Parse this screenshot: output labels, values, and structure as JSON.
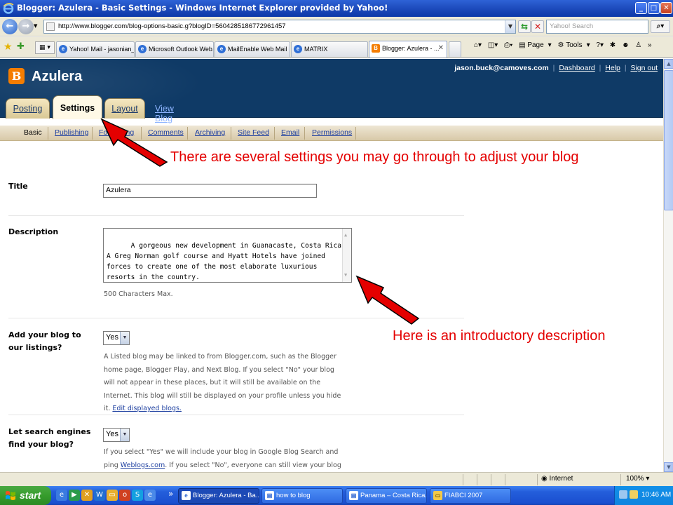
{
  "window": {
    "title": "Blogger: Azulera - Basic Settings - Windows Internet Explorer provided by Yahoo!",
    "controls": [
      "_",
      "□",
      "✕"
    ]
  },
  "address_bar": {
    "url": "http://www.blogger.com/blog-options-basic.g?blogID=5604285186772961457",
    "search_placeholder": "Yahoo! Search"
  },
  "browser_tabs": [
    {
      "label": "Yahoo! Mail - jasonian_..."
    },
    {
      "label": "Microsoft Outlook Web..."
    },
    {
      "label": "MailEnable Web Mail"
    },
    {
      "label": "MATRIX"
    },
    {
      "label": "Blogger: Azulera - ...",
      "active": true
    }
  ],
  "command_bar": {
    "page": "Page",
    "tools": "Tools"
  },
  "blogger": {
    "blog_name": "Azulera",
    "user_email": "jason.buck@camoves.com",
    "links": {
      "dashboard": "Dashboard",
      "help": "Help",
      "sign_out": "Sign out"
    },
    "main_tabs": {
      "posting": "Posting",
      "settings": "Settings",
      "layout": "Layout",
      "view_blog": "View Blog"
    },
    "sub_tabs": [
      "Basic",
      "Publishing",
      "Formatting",
      "Comments",
      "Archiving",
      "Site Feed",
      "Email",
      "Permissions"
    ]
  },
  "form": {
    "title_label": "Title",
    "title_value": "Azulera",
    "description_label": "Description",
    "description_value": "A gorgeous new development in Guanacaste, Costa Rica. A Greg Norman golf course and Hyatt Hotels have joined forces to create one of the most elaborate luxurious resorts in the country.",
    "description_hint": "500 Characters Max.",
    "listings_label": "Add your blog to our listings?",
    "listings_value": "Yes",
    "listings_hint": "A Listed blog may be linked to from Blogger.com, such as the Blogger home page, Blogger Play, and Next Blog. If you select \"No\" your blog will not appear in these places, but it will still be available on the Internet. This blog will still be displayed on your profile unless you hide it.",
    "listings_link": "Edit displayed blogs.",
    "search_label": "Let search engines find your blog?",
    "search_value": "Yes",
    "search_hint_pre": "If you select \"Yes\" we will include your blog in Google Blog Search and ping",
    "search_hint_link": "Weblogs.com",
    "search_hint_post": ". If you select \"No\", everyone can still view your blog but search"
  },
  "annotations": {
    "settings_note": "There are several settings you may go through to adjust your blog",
    "description_note": "Here is an introductory description",
    "arrow_color": "#e40000"
  },
  "status_bar": {
    "zone": "Internet",
    "zoom": "100%"
  },
  "taskbar": {
    "start": "start",
    "buttons": [
      {
        "label": "Blogger: Azulera - Ba...",
        "active": true
      },
      {
        "label": "how to blog"
      },
      {
        "label": "Panama – Costa Rica..."
      },
      {
        "label": "FIABCI 2007"
      }
    ],
    "overflow": "»",
    "clock": "10:46 AM"
  }
}
